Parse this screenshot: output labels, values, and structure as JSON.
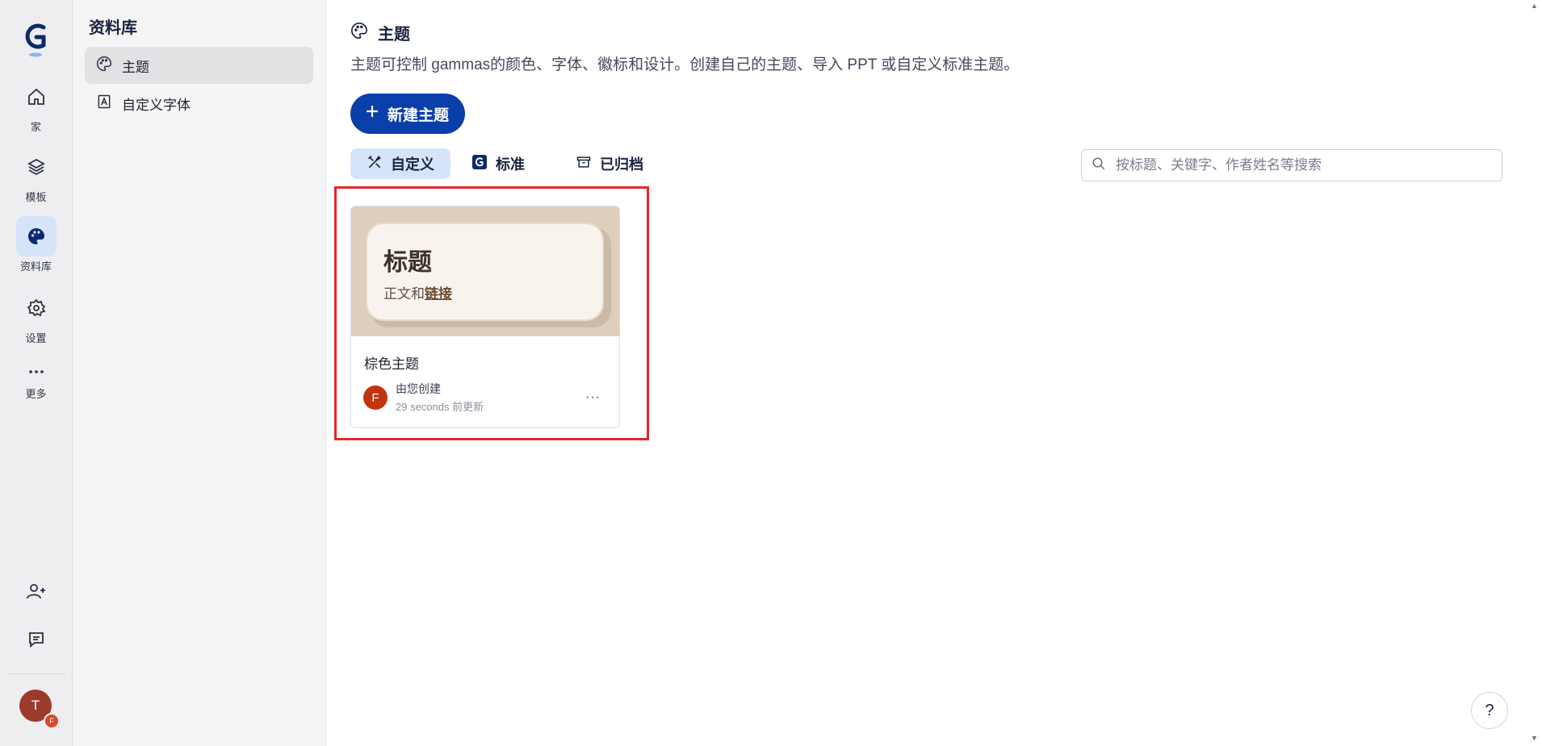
{
  "rail": {
    "logo": "G",
    "items": [
      {
        "label": "家",
        "icon": "home-icon"
      },
      {
        "label": "模板",
        "icon": "layers-icon"
      },
      {
        "label": "资料库",
        "icon": "palette-icon"
      },
      {
        "label": "设置",
        "icon": "gear-icon"
      },
      {
        "label": "更多",
        "icon": "more-icon"
      }
    ],
    "user_initial": "T",
    "workspace_initial": "F"
  },
  "nav": {
    "title": "资料库",
    "items": [
      {
        "label": "主题",
        "icon": "palette-icon"
      },
      {
        "label": "自定义字体",
        "icon": "font-icon"
      }
    ]
  },
  "main": {
    "title": "主题",
    "description": "主题可控制 gammas的颜色、字体、徽标和设计。创建自己的主题、导入 PPT 或自定义标准主题。",
    "new_button": "新建主题",
    "tabs": [
      {
        "label": "自定义",
        "icon": "custom-icon"
      },
      {
        "label": "标准",
        "icon": "gamma-logo-icon"
      },
      {
        "label": "已归档",
        "icon": "archive-icon"
      }
    ],
    "search_placeholder": "按标题、关键字、作者姓名等搜索",
    "card": {
      "preview_heading": "标题",
      "preview_body": "正文和",
      "preview_link": "链接",
      "name": "棕色主题",
      "owner_initial": "F",
      "owner": "由您创建",
      "updated": "29 seconds 前更新",
      "more": "···"
    }
  },
  "help_label": "?",
  "colors": {
    "accent": "#0a3ea9",
    "active_bg": "#d6e4fa",
    "highlight": "#e8262a"
  }
}
